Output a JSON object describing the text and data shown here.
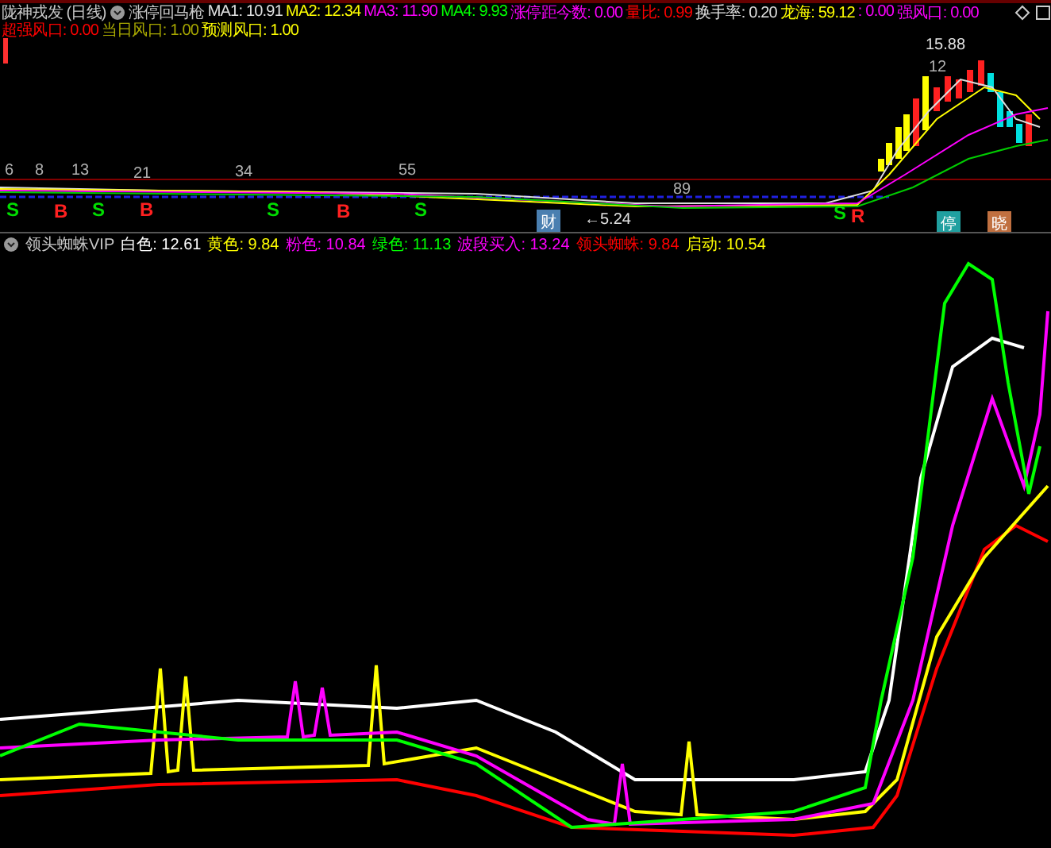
{
  "header": {
    "stock": "陇神戎发 (日线)",
    "indicator": "涨停回马枪",
    "values": [
      {
        "label": "MA1:",
        "value": "10.91",
        "color": "#e0e0e0"
      },
      {
        "label": "MA2:",
        "value": "12.34",
        "color": "#ffff00"
      },
      {
        "label": "MA3:",
        "value": "11.90",
        "color": "#ff00ff"
      },
      {
        "label": "MA4:",
        "value": "9.93",
        "color": "#00ff00"
      },
      {
        "label": "涨停距今数:",
        "value": "0.00",
        "color": "#ff00ff"
      },
      {
        "label": "量比:",
        "value": "0.99",
        "color": "#ff0000"
      },
      {
        "label": "换手率:",
        "value": "0.20",
        "color": "#e0e0e0"
      },
      {
        "label": "龙海:",
        "value": "59.12",
        "color": "#ffff00"
      },
      {
        "label": ":",
        "value": "0.00",
        "color": "#ff00ff"
      },
      {
        "label": "强风口:",
        "value": "0.00",
        "color": "#ff00ff"
      }
    ],
    "values_line2": [
      {
        "label": "超强风口:",
        "value": "0.00",
        "color": "#ff0000"
      },
      {
        "label": "当日风口:",
        "value": "1.00",
        "color": "#a8a800"
      },
      {
        "label": "预测风口:",
        "value": "1.00",
        "color": "#ffff00"
      }
    ]
  },
  "top_chart": {
    "markers": [
      {
        "text": "6",
        "kind": "count"
      },
      {
        "text": "S",
        "kind": "sell"
      },
      {
        "text": "8",
        "kind": "count"
      },
      {
        "text": "B",
        "kind": "buy"
      },
      {
        "text": "13",
        "kind": "count"
      },
      {
        "text": "S",
        "kind": "sell"
      },
      {
        "text": "21",
        "kind": "count"
      },
      {
        "text": "B",
        "kind": "buy"
      },
      {
        "text": "34",
        "kind": "count"
      },
      {
        "text": "S",
        "kind": "sell"
      },
      {
        "text": "B",
        "kind": "buy"
      },
      {
        "text": "55",
        "kind": "count"
      },
      {
        "text": "S",
        "kind": "sell"
      },
      {
        "text": "财",
        "kind": "tag",
        "color": "#4a7fb0"
      },
      {
        "text": "←5.24",
        "kind": "price"
      },
      {
        "text": "89",
        "kind": "count"
      },
      {
        "text": "S",
        "kind": "sell"
      },
      {
        "text": "R",
        "kind": "buy"
      },
      {
        "text": "15.88",
        "kind": "price"
      },
      {
        "text": "12",
        "kind": "count"
      },
      {
        "text": "停",
        "kind": "tag",
        "color": "#20a0a0"
      },
      {
        "text": "晓",
        "kind": "tag",
        "color": "#c07040"
      }
    ]
  },
  "bottom_chart": {
    "indicator": "领头蜘蛛VIP",
    "values": [
      {
        "label": "白色:",
        "value": "12.61",
        "color": "#ffffff"
      },
      {
        "label": "黄色:",
        "value": "9.84",
        "color": "#ffff00"
      },
      {
        "label": "粉色:",
        "value": "10.84",
        "color": "#ff00ff"
      },
      {
        "label": "绿色:",
        "value": "11.13",
        "color": "#00ff00"
      },
      {
        "label": "波段买入:",
        "value": "13.24",
        "color": "#ff00ff"
      },
      {
        "label": "领头蜘蛛:",
        "value": "9.84",
        "color": "#ff0000"
      },
      {
        "label": "启动:",
        "value": "10.54",
        "color": "#ffff00"
      }
    ]
  }
}
